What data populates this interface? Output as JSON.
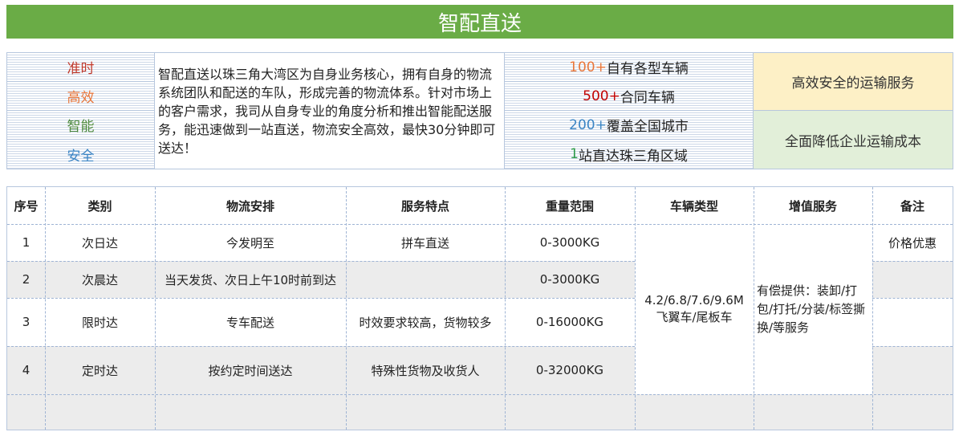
{
  "title": "智配直送",
  "tags": [
    {
      "label": "准时",
      "color": "#c0392b"
    },
    {
      "label": "高效",
      "color": "#e8763a"
    },
    {
      "label": "智能",
      "color": "#4e8a3e"
    },
    {
      "label": "安全",
      "color": "#3a84c4"
    }
  ],
  "description": "智配直送以珠三角大湾区为自身业务核心，拥有自身的物流系统团队和配送的车队，形成完善的物流体系。针对市场上的客户需求，我司从自身专业的角度分析和推出智能配送服务，能迅速做到一站直送，物流安全高效，最快30分钟即可送达！",
  "features": [
    {
      "num": "100",
      "plus": "+",
      "text": "自有各型车辆",
      "num_color": "#e8763a",
      "plus_color": "#e8763a"
    },
    {
      "num": "500",
      "plus": "+",
      "text": "合同车辆",
      "num_color": "#c00000",
      "plus_color": "#c00000"
    },
    {
      "num": "200",
      "plus": "+",
      "text": "覆盖全国城市",
      "num_color": "#3a84c4",
      "plus_color": "#3a84c4"
    },
    {
      "num": "1",
      "plus": "",
      "text": "站直达珠三角区域",
      "num_color": "#2e9a4a",
      "plus_color": "#2e9a4a"
    }
  ],
  "advantages": [
    {
      "text": "高效安全的运输服务",
      "bg": "#fdf0c6"
    },
    {
      "text": "全面降低企业运输成本",
      "bg": "#e2efd9"
    }
  ],
  "table": {
    "headers": [
      "序号",
      "类别",
      "物流安排",
      "服务特点",
      "重量范围",
      "车辆类型",
      "增值服务",
      "备注"
    ],
    "rows": [
      {
        "no": "1",
        "category": "次日达",
        "arrangement": "今发明至",
        "feature": "拼车直送",
        "weight": "0-3000KG",
        "note": "价格优惠"
      },
      {
        "no": "2",
        "category": "次晨达",
        "arrangement": "当天发货、次日上午10时前到达",
        "feature": "",
        "weight": "0-3000KG",
        "note": ""
      },
      {
        "no": "3",
        "category": "限时达",
        "arrangement": "专车配送",
        "feature": "时效要求较高，货物较多",
        "weight": "0-16000KG",
        "note": ""
      },
      {
        "no": "4",
        "category": "定时达",
        "arrangement": "按约定时间送达",
        "feature": "特殊性货物及收货人",
        "weight": "0-32000KG",
        "note": ""
      }
    ],
    "vehicle_type": "4.2/6.8/7.6/9.6M飞翼车/尾板车",
    "value_added": "有偿提供：装卸/打包/打托/分装/标签撕换/等服务"
  }
}
